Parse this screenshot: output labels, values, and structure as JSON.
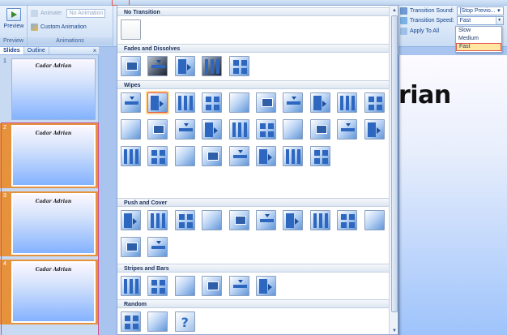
{
  "ribbon": {
    "preview_label": "Preview",
    "preview_group_label": "Preview",
    "animate_label": "Animate:",
    "animate_value": "No Animation",
    "custom_animation_label": "Custom Animation",
    "animations_group_label": "Animations",
    "transition_sound_label": "Transition Sound:",
    "transition_sound_value": "[Stop Previo...",
    "transition_speed_label": "Transition Speed:",
    "transition_speed_value": "Fast",
    "apply_to_all_label": "Apply To All"
  },
  "speed_options": [
    "Slow",
    "Medium",
    "Fast"
  ],
  "speed_selected": "Fast",
  "pane": {
    "tabs": [
      "Slides",
      "Outline"
    ],
    "active_tab": "Slides",
    "close_glyph": "×"
  },
  "slides": [
    {
      "number": "1",
      "title": "Cadar Adrian",
      "selected": false
    },
    {
      "number": "2",
      "title": "Cadar Adrian",
      "selected": true
    },
    {
      "number": "3",
      "title": "Cadar Adrian",
      "selected": true
    },
    {
      "number": "4",
      "title": "Cadar Adrian",
      "selected": true
    }
  ],
  "canvas": {
    "title_fragment": "rian"
  },
  "gallery": {
    "sections": [
      {
        "name": "No Transition",
        "count": 1
      },
      {
        "name": "Fades and Dissolves",
        "count": 5
      },
      {
        "name": "Wipes",
        "count": 28
      },
      {
        "name": "Push and Cover",
        "count": 12
      },
      {
        "name": "Stripes and Bars",
        "count": 6
      },
      {
        "name": "Random",
        "count": 3
      }
    ],
    "selected_section": "Wipes",
    "selected_index": 1,
    "random_glyph": "?"
  },
  "colors": {
    "accent_orange": "#e6923d",
    "highlight_red": "#e0564b",
    "ribbon_text": "#15428b"
  }
}
